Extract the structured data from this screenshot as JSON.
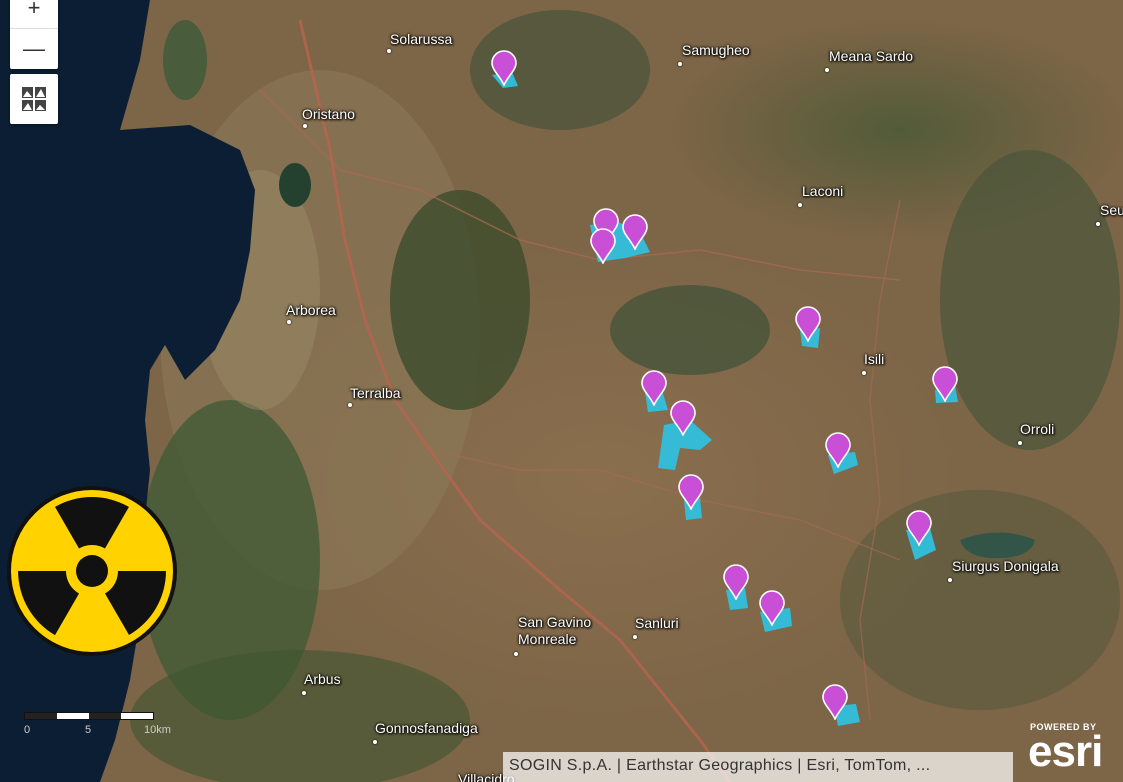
{
  "map": {
    "labels": [
      {
        "id": "solarussa",
        "text": "Solarussa"
      },
      {
        "id": "samugheo",
        "text": "Samugheo"
      },
      {
        "id": "meana-sardo",
        "text": "Meana Sardo"
      },
      {
        "id": "oristano",
        "text": "Oristano"
      },
      {
        "id": "laconi",
        "text": "Laconi"
      },
      {
        "id": "seu",
        "text": "Seu"
      },
      {
        "id": "arborea",
        "text": "Arborea"
      },
      {
        "id": "isili",
        "text": "Isili"
      },
      {
        "id": "terralba",
        "text": "Terralba"
      },
      {
        "id": "orroli",
        "text": "Orroli"
      },
      {
        "id": "siurgus-donigala",
        "text": "Siurgus Donigala"
      },
      {
        "id": "san-gavino-monreale",
        "text": "San Gavino\nMonreale"
      },
      {
        "id": "sanluri",
        "text": "Sanluri"
      },
      {
        "id": "arbus",
        "text": "Arbus"
      },
      {
        "id": "gonnosfanadiga",
        "text": "Gonnosfanadiga"
      },
      {
        "id": "villacidro",
        "text": "Villacidro"
      }
    ],
    "marker_color": "#c94fd6",
    "area_color": "#2ec4e6",
    "water_color": "#0c1e33"
  },
  "controls": {
    "zoom_in": "+",
    "zoom_out": "—",
    "basemap_icon": "basemap-gallery-icon"
  },
  "overlay": {
    "icon": "radiation-trefoil-icon",
    "fill": "#ffd200"
  },
  "scalebar": {
    "labels": [
      "0",
      "5",
      "10km"
    ]
  },
  "attribution": "SOGIN S.p.A. | Earthstar Geographics | Esri, TomTom, ...",
  "logo": {
    "powered_by": "POWERED BY",
    "brand": "esri"
  }
}
